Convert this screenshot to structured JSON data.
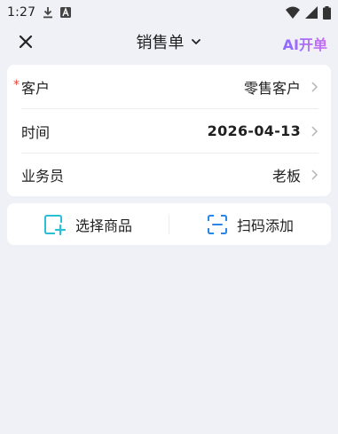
{
  "status_bar": {
    "time": "1:27",
    "icons": [
      "download-icon",
      "font-icon",
      "wifi-icon",
      "signal-icon",
      "battery-icon"
    ]
  },
  "nav": {
    "close_icon": "close-icon",
    "title": "销售单",
    "title_dropdown_icon": "chevron-down-icon",
    "ai_button": "AI开单"
  },
  "form": {
    "customer": {
      "label": "客户",
      "required_mark": "*",
      "value": "零售客户"
    },
    "time": {
      "label": "时间",
      "value": "2026-04-13"
    },
    "salesperson": {
      "label": "业务员",
      "value": "老板"
    }
  },
  "actions": {
    "select_goods": {
      "label": "选择商品",
      "icon": "add-goods-icon"
    },
    "scan_add": {
      "label": "扫码添加",
      "icon": "scan-icon"
    }
  },
  "colors": {
    "background": "#eff1f7",
    "card": "#ffffff",
    "accent_cyan": "#2bbfd6",
    "accent_blue": "#2a86e8",
    "ai_gradient_start": "#8b6cff",
    "ai_gradient_end": "#c86cf0",
    "required": "#e8453c"
  }
}
